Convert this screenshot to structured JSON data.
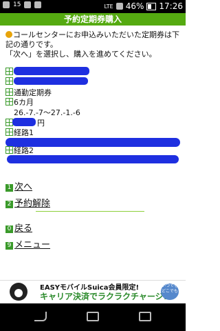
{
  "status": {
    "left_label": "15",
    "network": "LTE",
    "battery": "46%",
    "time": "17:26"
  },
  "header": {
    "title": "予約定期券購入"
  },
  "notice": {
    "line1": "コールセンターにお申込みいただいた定期券は下記の通りです。",
    "line2": "「次へ」を選択し、購入を進めてください。"
  },
  "details": {
    "type_label": "通勤定期券",
    "period_label": "6カ月",
    "date_range": "26.-7.-7〜27.-1.-6",
    "price_suffix": "円",
    "route1_label": "経路1",
    "route2_label": "経路2"
  },
  "actions": {
    "next": {
      "num": "1",
      "label": "次へ"
    },
    "cancel": {
      "num": "2",
      "label": "予約解除"
    },
    "back": {
      "num": "0",
      "label": "戻る"
    },
    "menu": {
      "num": "9",
      "label": "メニュー"
    }
  },
  "ad": {
    "line1": "EASYモバイルSuica会員限定!",
    "line2": "キャリア決済でラクラクチャージ!",
    "badge": "いつでも どこでも"
  },
  "colors": {
    "accent": "#55aa11",
    "redaction": "#1e2fe0"
  }
}
